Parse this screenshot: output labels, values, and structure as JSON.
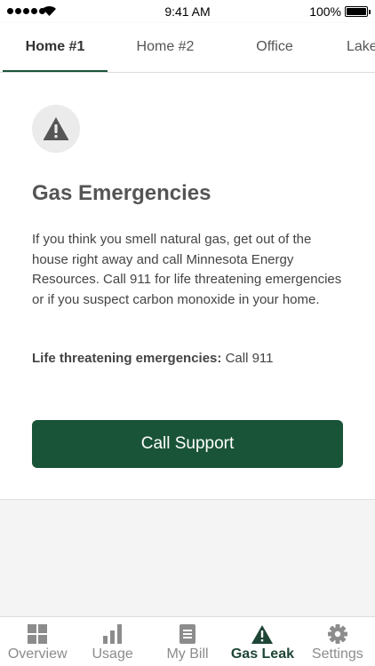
{
  "status_bar": {
    "time": "9:41 AM",
    "battery": "100%"
  },
  "tabs": [
    {
      "label": "Home #1",
      "active": true
    },
    {
      "label": "Home #2",
      "active": false
    },
    {
      "label": "Office",
      "active": false
    },
    {
      "label": "Lake",
      "active": false
    }
  ],
  "content": {
    "icon": "warning-icon",
    "heading": "Gas Emergencies",
    "body": "If you think you smell natural gas, get out of the house right away and call Minnesota Energy Resources. Call 911 for life threatening emergencies or if you suspect carbon monoxide in your home.",
    "emergency_label": "Life threatening emergencies:",
    "emergency_value": "Call 911",
    "call_button": "Call Support"
  },
  "bottom_nav": [
    {
      "label": "Overview",
      "icon": "grid-icon",
      "active": false
    },
    {
      "label": "Usage",
      "icon": "bar-chart-icon",
      "active": false
    },
    {
      "label": "My Bill",
      "icon": "bill-icon",
      "active": false
    },
    {
      "label": "Gas Leak",
      "icon": "warning-icon",
      "active": true
    },
    {
      "label": "Settings",
      "icon": "gear-icon",
      "active": false
    }
  ],
  "colors": {
    "brand_green": "#1a5438",
    "active_nav": "#1e4535",
    "inactive_nav": "#8c8c8c"
  }
}
